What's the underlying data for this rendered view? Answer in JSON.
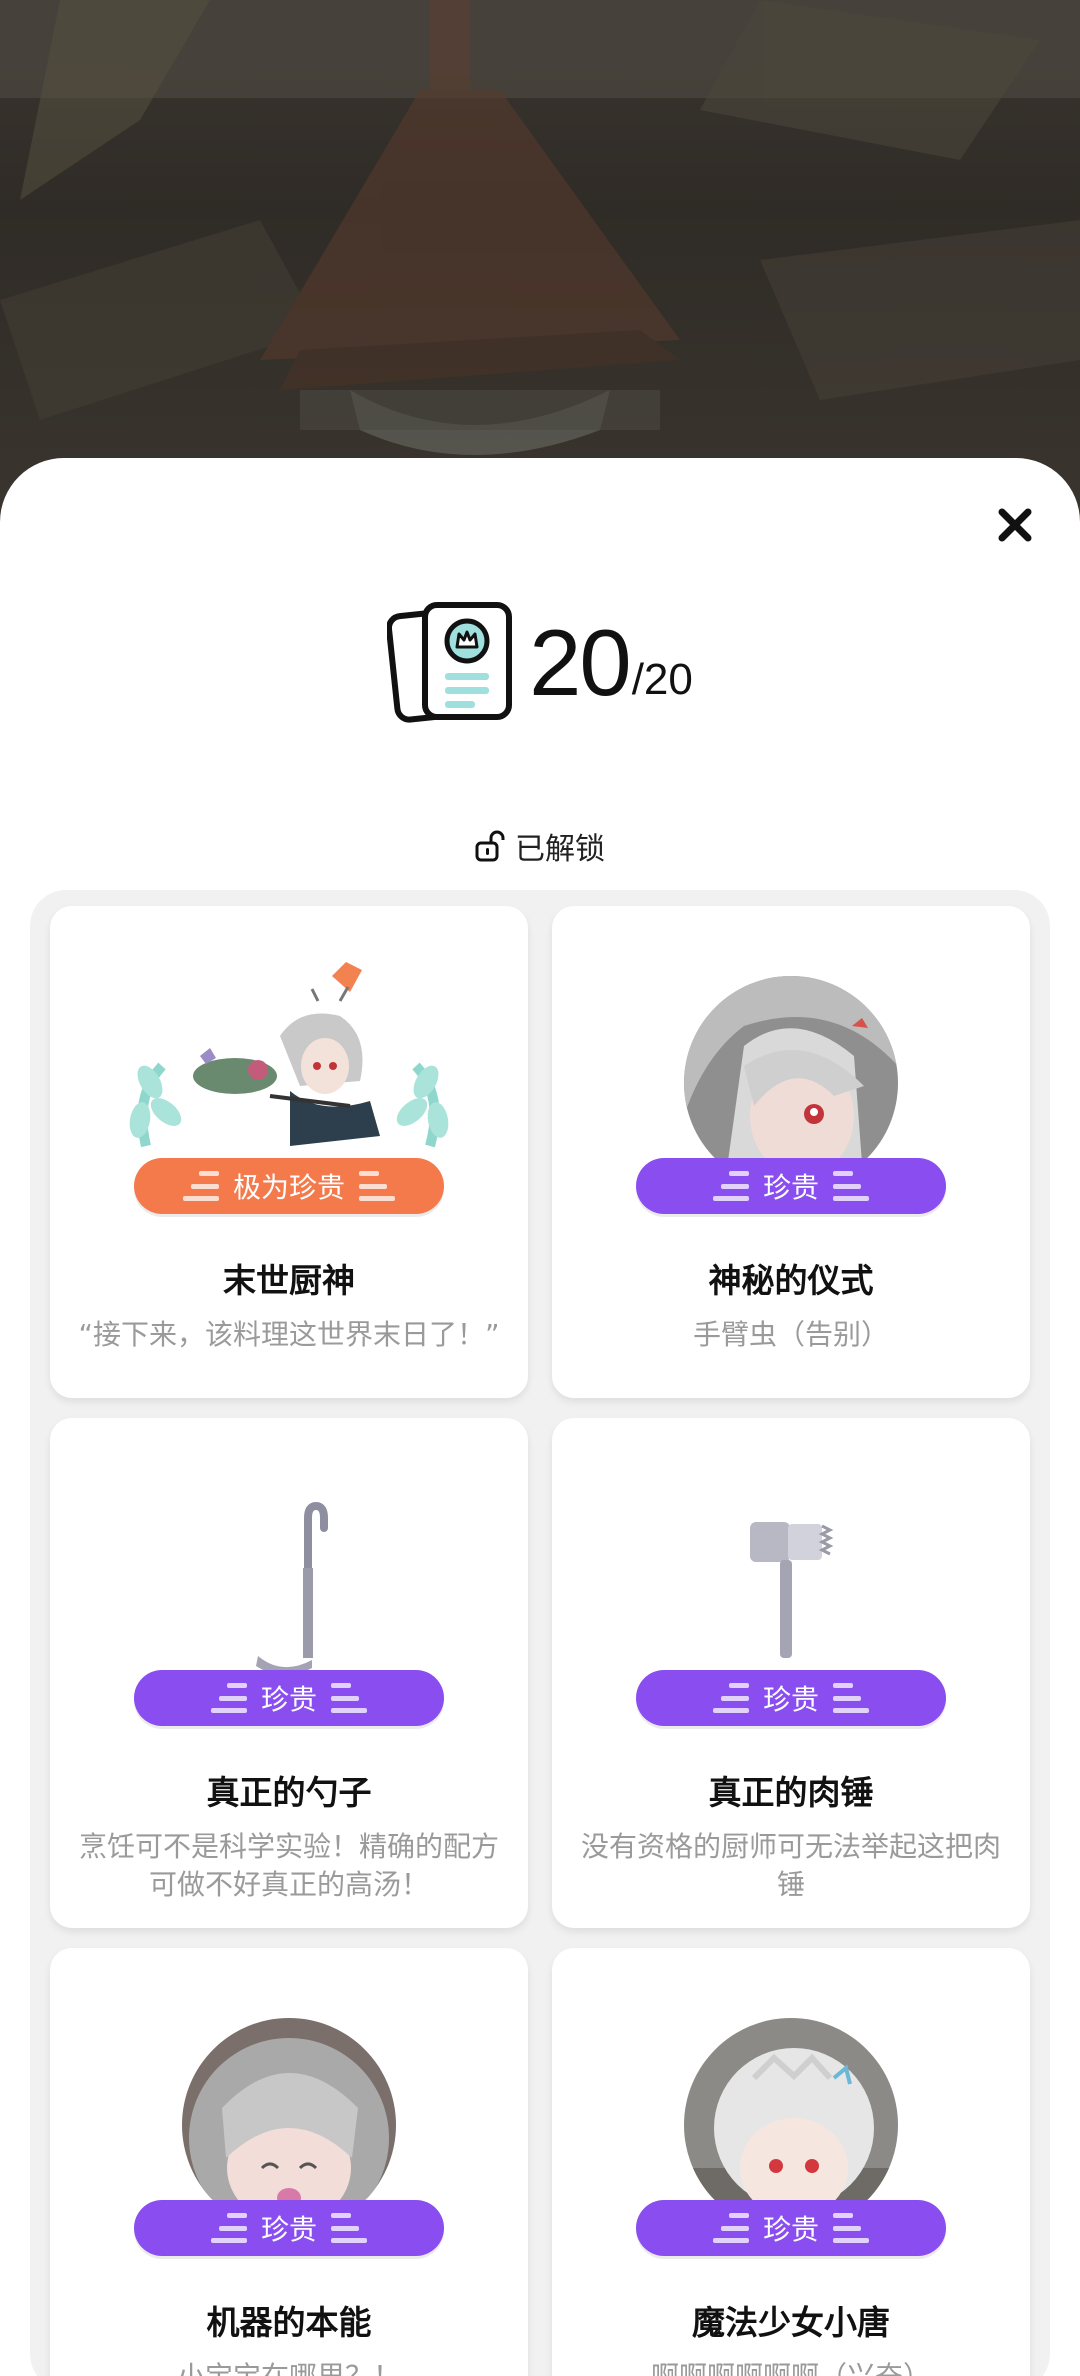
{
  "header": {
    "count": "20",
    "total": "/20"
  },
  "unlock": {
    "label": "已解锁"
  },
  "cards": [
    {
      "title": "末世厨神",
      "desc": "“接下来，该料理这世界末日了！”",
      "badge": "极为珍贵",
      "badge_color": "#f47a4c"
    },
    {
      "title": "神秘的仪式",
      "desc": "手臂虫（告别）",
      "badge": "珍贵",
      "badge_color": "#8a4df0"
    },
    {
      "title": "真正的勺子",
      "desc": "烹饪可不是科学实验！精确的配方可做不好真正的高汤！",
      "badge": "珍贵",
      "badge_color": "#8a4df0"
    },
    {
      "title": "真正的肉锤",
      "desc": "没有资格的厨师可无法举起这把肉锤",
      "badge": "珍贵",
      "badge_color": "#8a4df0"
    },
    {
      "title": "机器的本能",
      "desc": "小宝宝在哪里？！",
      "badge": "珍贵",
      "badge_color": "#8a4df0"
    },
    {
      "title": "魔法少女小唐",
      "desc": "啊啊啊啊啊啊（兴奋）",
      "badge": "珍贵",
      "badge_color": "#8a4df0"
    }
  ],
  "icons": {
    "close": "close-icon",
    "collection": "collection-card-icon",
    "unlock": "unlock-icon"
  }
}
